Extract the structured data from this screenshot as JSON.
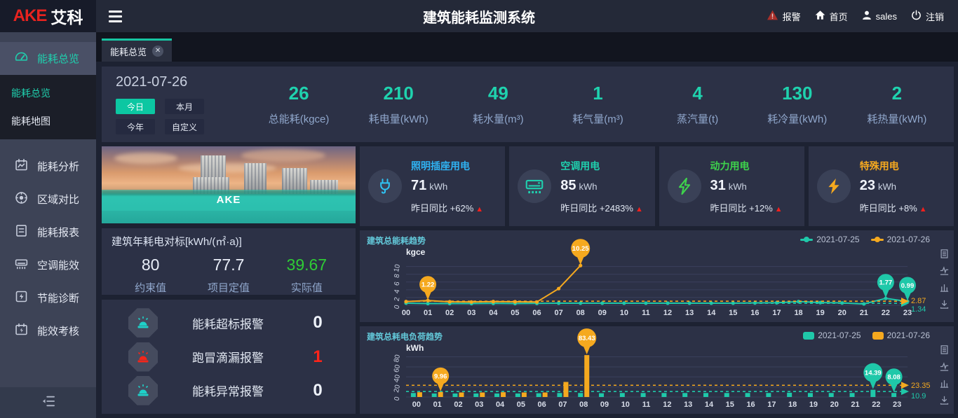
{
  "header": {
    "logo_red": "AKE",
    "logo_white": "艾科",
    "title": "建筑能耗监测系统",
    "nav": [
      {
        "label": "报警",
        "icon": "alarm-icon"
      },
      {
        "label": "首页",
        "icon": "home-icon"
      },
      {
        "label": "sales",
        "icon": "user-icon"
      },
      {
        "label": "注销",
        "icon": "logout-icon"
      }
    ]
  },
  "sidebar": {
    "items": [
      {
        "label": "能耗总览",
        "icon": "gauge-icon",
        "active": true
      },
      {
        "label": "能耗分析",
        "icon": "analysis-icon"
      },
      {
        "label": "区域对比",
        "icon": "region-compare-icon"
      },
      {
        "label": "能耗报表",
        "icon": "report-icon"
      },
      {
        "label": "空调能效",
        "icon": "hvac-icon"
      },
      {
        "label": "节能诊断",
        "icon": "diagnosis-icon"
      },
      {
        "label": "能效考核",
        "icon": "assessment-icon"
      }
    ],
    "submenu": [
      {
        "label": "能耗总览",
        "active": true
      },
      {
        "label": "能耗地图",
        "active": false
      }
    ]
  },
  "tab": {
    "label": "能耗总览",
    "close": "✕"
  },
  "summary": {
    "date": "2021-07-26",
    "range_buttons": [
      {
        "label": "今日",
        "active": true
      },
      {
        "label": "本月",
        "active": false
      },
      {
        "label": "今年",
        "active": false
      },
      {
        "label": "自定义",
        "active": false
      }
    ],
    "stats": [
      {
        "value": "26",
        "label": "总能耗(kgce)"
      },
      {
        "value": "210",
        "label": "耗电量(kWh)"
      },
      {
        "value": "49",
        "label": "耗水量(m³)"
      },
      {
        "value": "1",
        "label": "耗气量(m³)"
      },
      {
        "value": "4",
        "label": "蒸汽量(t)"
      },
      {
        "value": "130",
        "label": "耗冷量(kWh)"
      },
      {
        "value": "2",
        "label": "耗热量(kWh)"
      }
    ]
  },
  "building": {
    "name": "AKE"
  },
  "benchmark": {
    "title": "建筑年耗电对标[kWh/(㎡·a)]",
    "items": [
      {
        "value": "80",
        "label": "约束值",
        "color": "#e9eef8"
      },
      {
        "value": "77.7",
        "label": "项目定值",
        "color": "#e9eef8"
      },
      {
        "value": "39.67",
        "label": "实际值",
        "color": "#2ecc35"
      }
    ]
  },
  "alarms": [
    {
      "label": "能耗超标报警",
      "value": "0",
      "value_color": "#eef2fa",
      "icon_color": "#1fd0c8"
    },
    {
      "label": "跑冒滴漏报警",
      "value": "1",
      "value_color": "#ff2419",
      "icon_color": "#f3261a"
    },
    {
      "label": "能耗异常报警",
      "value": "0",
      "value_color": "#eef2fa",
      "icon_color": "#1fd0c8"
    }
  ],
  "energy_cards": [
    {
      "title": "照明插座用电",
      "value": "71",
      "unit": "kWh",
      "yoy_label": "昨日同比",
      "yoy_value": "+62%",
      "color": "#2fb2f2",
      "icon": "plug-icon"
    },
    {
      "title": "空调用电",
      "value": "85",
      "unit": "kWh",
      "yoy_label": "昨日同比",
      "yoy_value": "+2483%",
      "color": "#1fd0ae",
      "icon": "ac-icon"
    },
    {
      "title": "动力用电",
      "value": "31",
      "unit": "kWh",
      "yoy_label": "昨日同比",
      "yoy_value": "+12%",
      "color": "#3ed34c",
      "icon": "bolt-green-icon"
    },
    {
      "title": "特殊用电",
      "value": "23",
      "unit": "kWh",
      "yoy_label": "昨日同比",
      "yoy_value": "+8%",
      "color": "#f5a91f",
      "icon": "bolt-orange-icon"
    }
  ],
  "chart_data": [
    {
      "type": "line",
      "title": "建筑总能耗趋势",
      "ylabel": "kgce",
      "x": [
        "00",
        "01",
        "02",
        "03",
        "04",
        "05",
        "06",
        "07",
        "08",
        "09",
        "10",
        "11",
        "12",
        "13",
        "14",
        "15",
        "16",
        "17",
        "18",
        "19",
        "20",
        "21",
        "22",
        "23"
      ],
      "ylim": [
        0,
        13
      ],
      "yticks": [
        "0",
        "2",
        "4",
        "6",
        "8",
        "10"
      ],
      "legend_position": "top-right",
      "grid": true,
      "series": [
        {
          "name": "2021-07-25",
          "color": "#1fc8a9",
          "values": [
            0.55,
            0.45,
            0.45,
            0.45,
            0.5,
            0.45,
            0.5,
            0.55,
            0.55,
            0.55,
            0.55,
            0.55,
            0.55,
            0.55,
            0.55,
            0.55,
            0.6,
            0.65,
            0.95,
            0.7,
            0.6,
            0.35,
            1.77,
            0.99
          ],
          "pins": [
            {
              "i": 22,
              "label": "1.77"
            },
            {
              "i": 23,
              "label": "0.99"
            }
          ],
          "markline": {
            "y": 0.5,
            "label": "1.34",
            "label_dy": 8
          }
        },
        {
          "name": "2021-07-26",
          "color": "#f5a91f",
          "values": [
            0.95,
            1.22,
            0.9,
            0.85,
            0.95,
            0.9,
            0.85,
            4.3,
            10.25
          ],
          "pins": [
            {
              "i": 1,
              "label": "1.22"
            },
            {
              "i": 8,
              "label": "10.25"
            }
          ],
          "markline": {
            "y": 1.05,
            "label": "2.87",
            "label_dy": -1
          }
        }
      ]
    },
    {
      "type": "bar",
      "title": "建筑总耗电负荷趋势",
      "ylabel": "kWh",
      "x": [
        "00",
        "01",
        "02",
        "03",
        "04",
        "05",
        "06",
        "07",
        "08",
        "09",
        "10",
        "11",
        "12",
        "13",
        "14",
        "15",
        "16",
        "17",
        "18",
        "19",
        "20",
        "21",
        "22",
        "23"
      ],
      "ylim": [
        0,
        92
      ],
      "yticks": [
        "0",
        "20",
        "40",
        "60",
        "80"
      ],
      "legend_position": "top-right",
      "grid": true,
      "series": [
        {
          "name": "2021-07-25",
          "color": "#1fc8a9",
          "values": [
            8,
            7,
            7,
            7,
            7,
            7,
            7.5,
            8,
            8,
            7.5,
            8,
            8,
            8,
            8,
            8,
            8,
            8,
            8,
            8.5,
            8,
            8,
            8,
            14.39,
            8.08
          ],
          "pins": [
            {
              "i": 22,
              "label": "14.39"
            },
            {
              "i": 23,
              "label": "8.08"
            }
          ],
          "markline": {
            "y": 10.9,
            "label": "10.9",
            "label_dy": 6
          }
        },
        {
          "name": "2021-07-26",
          "color": "#f5a91f",
          "values": [
            9.5,
            9.96,
            9,
            9,
            9.5,
            9,
            9,
            30,
            83.43
          ],
          "pins": [
            {
              "i": 1,
              "label": "9.96"
            },
            {
              "i": 8,
              "label": "83.43"
            }
          ],
          "markline": {
            "y": 23.35,
            "label": "23.35",
            "label_dy": 0
          }
        }
      ]
    }
  ]
}
